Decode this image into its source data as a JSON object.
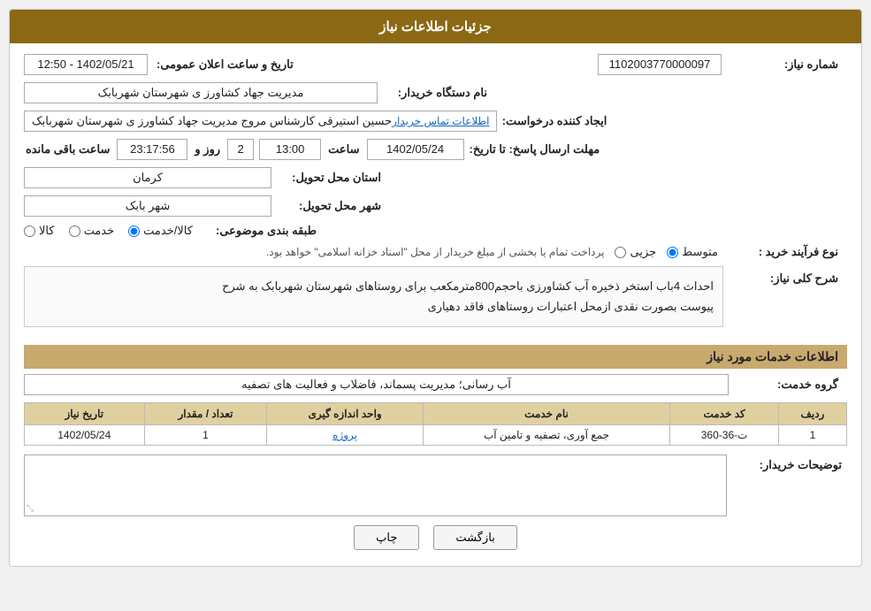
{
  "header": {
    "title": "جزئیات اطلاعات نیاز"
  },
  "fields": {
    "shomara_niaz_label": "شماره نیاز:",
    "shomara_niaz_value": "1102003770000097",
    "nam_dastgah_label": "نام دستگاه خریدار:",
    "nam_dastgah_value": "مدیریت جهاد کشاورز ی شهرستان شهربابک",
    "ijad_konande_label": "ایجاد کننده درخواست:",
    "ijad_konande_value": "حسین استیرقی کارشناس مروج مدیریت جهاد کشاورز ی شهرستان شهربابک",
    "atelaat_tamas": "اطلاعات تماس خریدار",
    "mohlat_label": "مهلت ارسال پاسخ: تا تاریخ:",
    "mohlat_date": "1402/05/24",
    "mohlat_time_label": "ساعت",
    "mohlat_time": "13:00",
    "mohlat_rooz_label": "روز و",
    "mohlat_rooz": "2",
    "mohlat_countdown": "23:17:56",
    "mohlat_countdown_label": "ساعت باقی مانده",
    "ostan_label": "استان محل تحویل:",
    "ostan_value": "کرمان",
    "shahr_label": "شهر محل تحویل:",
    "shahr_value": "شهر بابک",
    "tabaqebandi_label": "طبقه بندی موضوعی:",
    "radio_kala": "کالا",
    "radio_khedmat": "خدمت",
    "radio_kala_khedmat": "کالا/خدمت",
    "radio_kala_khedmat_selected": true,
    "nooe_farayand_label": "نوع فرآیند خرید :",
    "radio_jozei": "جزیی",
    "radio_motavasset": "متوسط",
    "radio_motavasset_selected": true,
    "farayand_description": "پرداخت تمام یا بخشی از مبلغ خریدار از محل \"اسناد خزانه اسلامی\" خواهد بود.",
    "sharh_label": "شرح کلی نیاز:",
    "sharh_text1": "احداث 4باب استخر ذخیره آب کشاورزی باحجم800مترمکعب برای روستاهای شهرستان شهربابک به شرح",
    "sharh_text2": "پیوست بصورت نقدی ازمحل اعتبارات روستاهای فاقد دهیاری",
    "khadamat_label": "اطلاعات خدمات مورد نیاز",
    "grooh_label": "گروه خدمت:",
    "grooh_value": "آب رسانی؛ مدیریت پسماند، فاضلاب و فعالیت های تصفیه",
    "table_headers": [
      "ردیف",
      "کد خدمت",
      "نام خدمت",
      "واحد اندازه گیری",
      "تعداد / مقدار",
      "تاریخ نیاز"
    ],
    "table_rows": [
      {
        "radif": "1",
        "kod_khedmat": "ت-36-360",
        "nam_khedmat": "جمع آوری، تصفیه و تامین آب",
        "vahed": "پروژه",
        "tedad": "1",
        "tarikh": "1402/05/24"
      }
    ],
    "tozihat_label": "توضیحات خریدار:",
    "btn_chap": "چاپ",
    "btn_bazgasht": "بازگشت",
    "tarikh_label": "تاریخ و ساعت اعلان عمومی:",
    "tarikh_value": "1402/05/21 - 12:50"
  }
}
